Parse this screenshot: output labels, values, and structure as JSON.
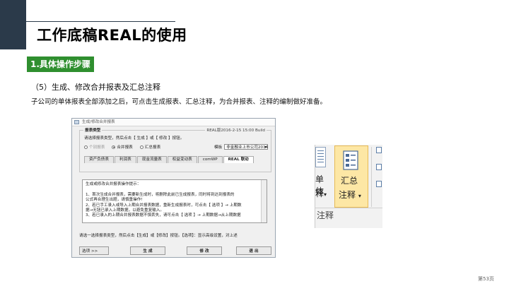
{
  "slide": {
    "title": "工作底稿REAL的使用",
    "section_badge": "1.具体操作步骤",
    "subheading": "（5）生成、修改合并报表及汇总注释",
    "description": "子公司的单体报表全部添加之后，可点击生成报表、汇总注释，为合并报表、注释的编制做好准备。",
    "page_number": "第53页",
    "accent_color": "#2f8f2f",
    "corner_color": "#2b3a4a"
  },
  "dialog": {
    "title": "生成/修改合并报表",
    "group_label": "报表类型",
    "version": "REAL版2016-2-15 15:00 Build",
    "instruction": "请选择报表类型，然后点击【 生成 】或【 修改 】按钮。",
    "radios": [
      {
        "label": "个别报表",
        "selected": false,
        "disabled": true
      },
      {
        "label": "合并报表",
        "selected": true,
        "disabled": false
      },
      {
        "label": "汇总报表",
        "selected": false,
        "disabled": false
      }
    ],
    "template_label": "模板",
    "template_value": "非金融业上市公司2014",
    "tabs": [
      "资产负债表",
      "利润表",
      "现金流量表",
      "权益变动表",
      "comWP",
      "REAL 联动"
    ],
    "active_tab": 5,
    "notes": [
      "生成或修改合并报表操作提示：",
      "",
      "1、首次生成合并报表，需要新生成时，将删除此前已生成报表，同时将到达到报表的",
      "公式再合理生出题，请慎重操作!",
      "2、若已手工录入或导入上期合并报表数据，重新生成报表时，可点击【 选项 】→ 上期数",
      "据→无钮已录入上期数据，以避免重复输入。",
      "3、若已录入的上期合并报表数据不慎丢失，请可点击【 选项 】→ 上期数据→从上期数据"
    ],
    "footer_text": "请选一选择报表类型，然后点击【生成】或【修改】按钮。【选项】：显示高级设置，对上述",
    "buttons": {
      "options": "选项 >>",
      "generate": "生 成",
      "modify": "修 改",
      "exit": "退 出"
    }
  },
  "ribbon": {
    "left_label_1": "单体",
    "left_label_2": "释",
    "left_caret": "▾",
    "summary_label_1": "汇总",
    "summary_label_2": "注释",
    "summary_caret": "▾",
    "group_name": "注释"
  }
}
